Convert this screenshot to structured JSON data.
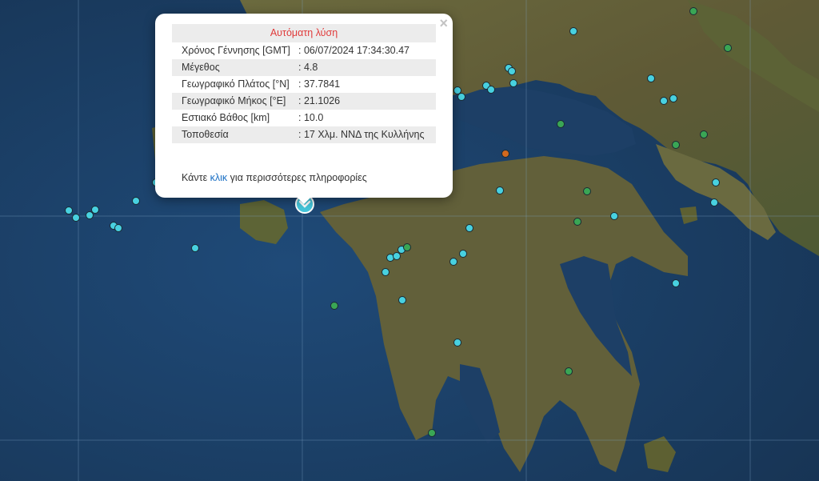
{
  "popup": {
    "title": "Αυτόματη λύση",
    "rows": [
      {
        "label": "Χρόνος Γέννησης [GMT]",
        "value": ": 06/07/2024 17:34:30.47"
      },
      {
        "label": "Μέγεθος",
        "value": ": 4.8"
      },
      {
        "label": "Γεωγραφικό Πλάτος [°N]",
        "value": ": 37.7841"
      },
      {
        "label": "Γεωγραφικό Μήκος [°E]",
        "value": ": 21.1026"
      },
      {
        "label": "Εστιακό Βάθος [km]",
        "value": ": 10.0"
      },
      {
        "label": "Τοποθεσία",
        "value": ": 17 Χλμ. ΝΝΔ της Κυλλήνης"
      }
    ],
    "footer_before": "Κάντε ",
    "footer_link": "κλικ",
    "footer_after": " για περισσότερες πληροφορίες",
    "close_symbol": "×"
  },
  "colors": {
    "cyan_marker": "#48d1e0",
    "green_marker": "#3aa655",
    "orange_marker": "#d2691e",
    "selected_marker": "#45c6db",
    "popup_title": "#e03a3a",
    "link": "#1a6fc4"
  },
  "markers": {
    "cyan": 40,
    "green": 10,
    "orange": 1,
    "selected": 1
  }
}
